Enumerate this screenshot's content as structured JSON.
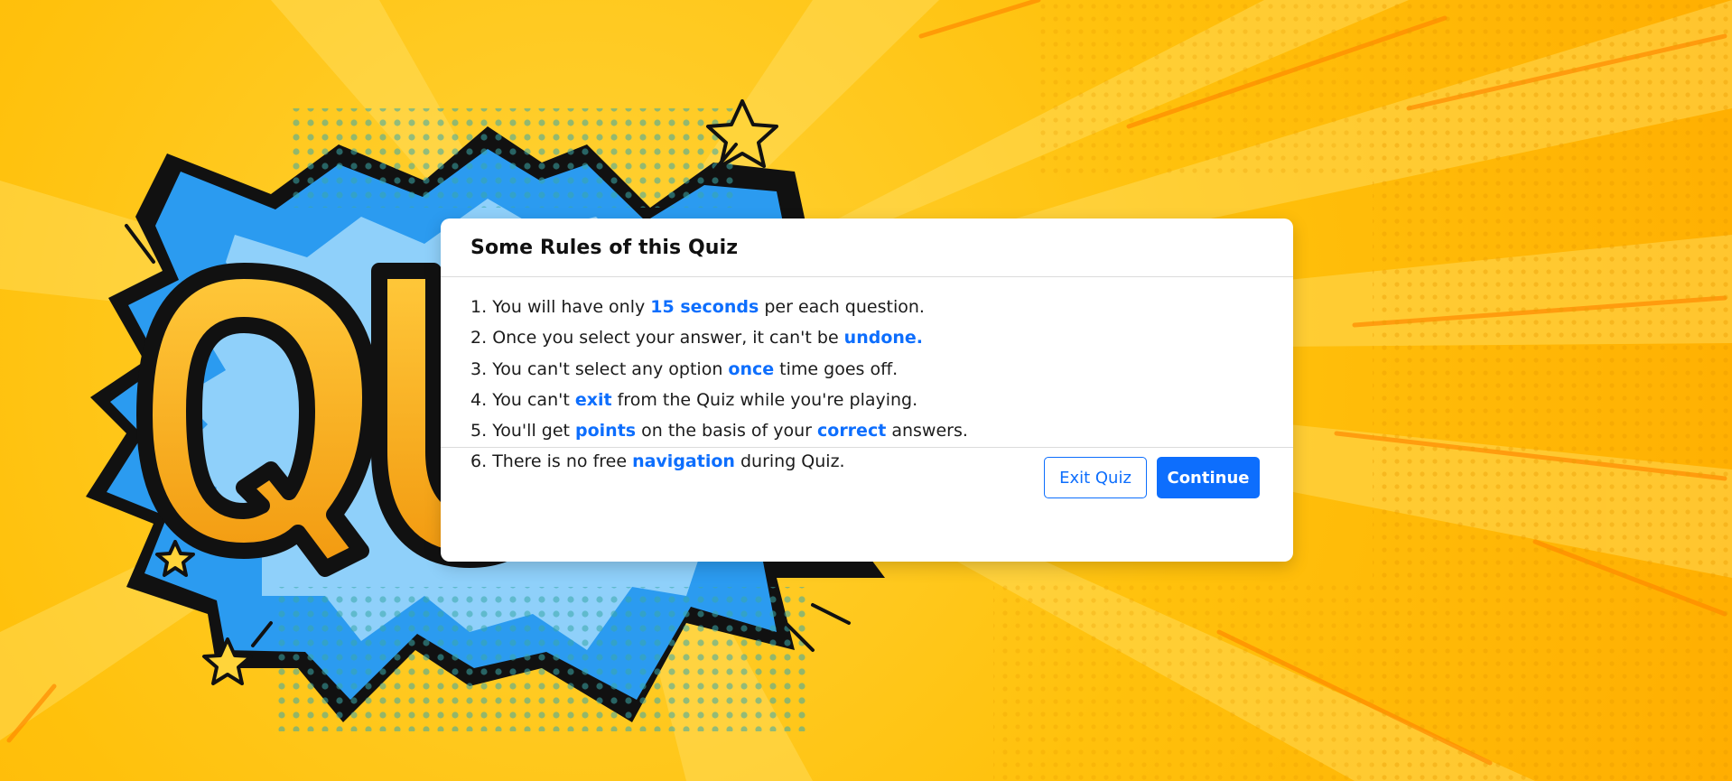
{
  "background": {
    "illustration_text": "QUIZ",
    "colors": {
      "base": "#ffc20e",
      "burst_dark": "#111111",
      "burst_blue": "#2b9bf0",
      "burst_light_blue": "#8fd0fa",
      "letters": "#f7a91a"
    }
  },
  "dialog": {
    "title": "Some Rules of this Quiz",
    "rules": [
      {
        "number": "1.",
        "pre": "You will have only ",
        "highlight": "15 seconds",
        "post": " per each question."
      },
      {
        "number": "2.",
        "pre": "Once you select your answer, it can't be ",
        "highlight": "undone.",
        "post": ""
      },
      {
        "number": "3.",
        "pre": "You can't select any option ",
        "highlight": "once",
        "post": " time goes off."
      },
      {
        "number": "4.",
        "pre": "You can't ",
        "highlight": "exit",
        "post": " from the Quiz while you're playing."
      },
      {
        "number": "5.",
        "pre": "You'll get ",
        "highlight": "points",
        "post": " on the basis of your ",
        "highlight2": "correct",
        "post2": " answers."
      },
      {
        "number": "6.",
        "pre": "There is no free ",
        "highlight": "navigation",
        "post": " during Quiz."
      }
    ],
    "buttons": {
      "exit_label": "Exit Quiz",
      "continue_label": "Continue"
    },
    "accent_color": "#0d6efd"
  }
}
